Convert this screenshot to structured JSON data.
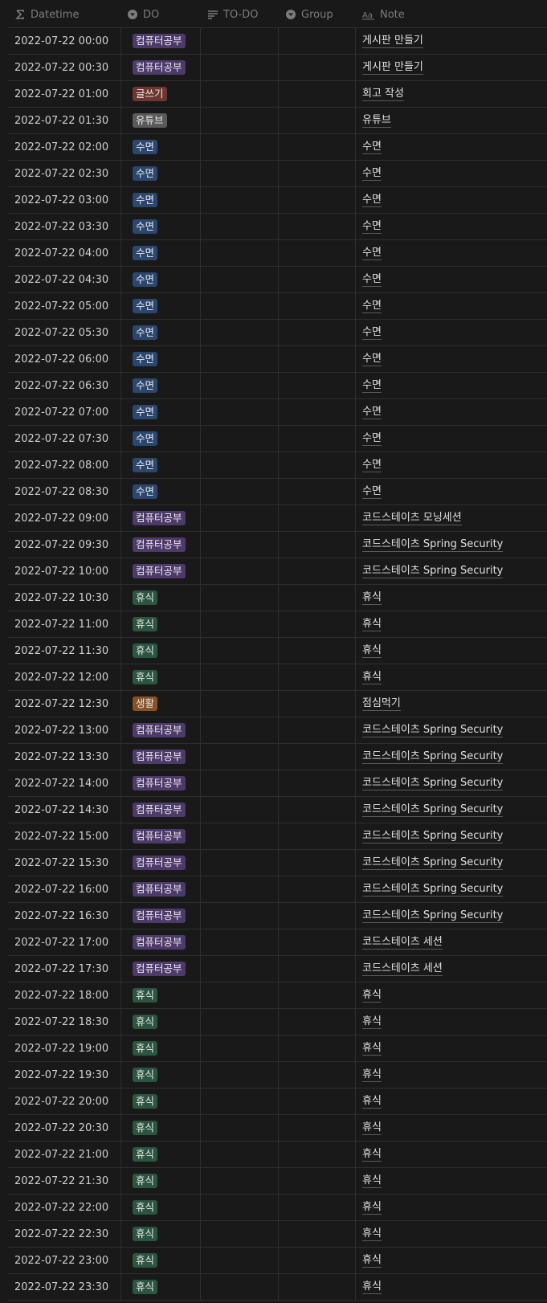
{
  "columns": [
    {
      "key": "datetime",
      "label": "Datetime",
      "icon": "sigma-icon"
    },
    {
      "key": "do",
      "label": "DO",
      "icon": "select-icon"
    },
    {
      "key": "todo",
      "label": "TO-DO",
      "icon": "text-lines-icon"
    },
    {
      "key": "group",
      "label": "Group",
      "icon": "select-icon"
    },
    {
      "key": "note",
      "label": "Note",
      "icon": "text-aa-icon"
    }
  ],
  "tag_colors": {
    "컴퓨터공부": "#4d3a6b",
    "글쓰기": "#6e3630",
    "유튜브": "#5a5a5a",
    "수면": "#2b4770",
    "휴식": "#2b5540",
    "생활": "#8a5224"
  },
  "rows": [
    {
      "datetime": "2022-07-22 00:00",
      "do": "컴퓨터공부",
      "note": "게시판 만들기"
    },
    {
      "datetime": "2022-07-22 00:30",
      "do": "컴퓨터공부",
      "note": "게시판 만들기"
    },
    {
      "datetime": "2022-07-22 01:00",
      "do": "글쓰기",
      "note": "회고 작성"
    },
    {
      "datetime": "2022-07-22 01:30",
      "do": "유튜브",
      "note": "유튜브"
    },
    {
      "datetime": "2022-07-22 02:00",
      "do": "수면",
      "note": "수면"
    },
    {
      "datetime": "2022-07-22 02:30",
      "do": "수면",
      "note": "수면"
    },
    {
      "datetime": "2022-07-22 03:00",
      "do": "수면",
      "note": "수면"
    },
    {
      "datetime": "2022-07-22 03:30",
      "do": "수면",
      "note": "수면"
    },
    {
      "datetime": "2022-07-22 04:00",
      "do": "수면",
      "note": "수면"
    },
    {
      "datetime": "2022-07-22 04:30",
      "do": "수면",
      "note": "수면"
    },
    {
      "datetime": "2022-07-22 05:00",
      "do": "수면",
      "note": "수면"
    },
    {
      "datetime": "2022-07-22 05:30",
      "do": "수면",
      "note": "수면"
    },
    {
      "datetime": "2022-07-22 06:00",
      "do": "수면",
      "note": "수면"
    },
    {
      "datetime": "2022-07-22 06:30",
      "do": "수면",
      "note": "수면"
    },
    {
      "datetime": "2022-07-22 07:00",
      "do": "수면",
      "note": "수면"
    },
    {
      "datetime": "2022-07-22 07:30",
      "do": "수면",
      "note": "수면"
    },
    {
      "datetime": "2022-07-22 08:00",
      "do": "수면",
      "note": "수면"
    },
    {
      "datetime": "2022-07-22 08:30",
      "do": "수면",
      "note": "수면"
    },
    {
      "datetime": "2022-07-22 09:00",
      "do": "컴퓨터공부",
      "note": "코드스테이츠 모닝세션"
    },
    {
      "datetime": "2022-07-22 09:30",
      "do": "컴퓨터공부",
      "note": "코드스테이츠 Spring Security"
    },
    {
      "datetime": "2022-07-22 10:00",
      "do": "컴퓨터공부",
      "note": "코드스테이츠 Spring Security"
    },
    {
      "datetime": "2022-07-22 10:30",
      "do": "휴식",
      "note": "휴식"
    },
    {
      "datetime": "2022-07-22 11:00",
      "do": "휴식",
      "note": "휴식"
    },
    {
      "datetime": "2022-07-22 11:30",
      "do": "휴식",
      "note": "휴식"
    },
    {
      "datetime": "2022-07-22 12:00",
      "do": "휴식",
      "note": "휴식"
    },
    {
      "datetime": "2022-07-22 12:30",
      "do": "생활",
      "note": "점심먹기"
    },
    {
      "datetime": "2022-07-22 13:00",
      "do": "컴퓨터공부",
      "note": "코드스테이츠 Spring Security"
    },
    {
      "datetime": "2022-07-22 13:30",
      "do": "컴퓨터공부",
      "note": "코드스테이츠 Spring Security"
    },
    {
      "datetime": "2022-07-22 14:00",
      "do": "컴퓨터공부",
      "note": "코드스테이츠 Spring Security"
    },
    {
      "datetime": "2022-07-22 14:30",
      "do": "컴퓨터공부",
      "note": "코드스테이츠 Spring Security"
    },
    {
      "datetime": "2022-07-22 15:00",
      "do": "컴퓨터공부",
      "note": "코드스테이츠 Spring Security"
    },
    {
      "datetime": "2022-07-22 15:30",
      "do": "컴퓨터공부",
      "note": "코드스테이츠 Spring Security"
    },
    {
      "datetime": "2022-07-22 16:00",
      "do": "컴퓨터공부",
      "note": "코드스테이츠 Spring Security"
    },
    {
      "datetime": "2022-07-22 16:30",
      "do": "컴퓨터공부",
      "note": "코드스테이츠 Spring Security"
    },
    {
      "datetime": "2022-07-22 17:00",
      "do": "컴퓨터공부",
      "note": "코드스테이츠 세션"
    },
    {
      "datetime": "2022-07-22 17:30",
      "do": "컴퓨터공부",
      "note": "코드스테이츠 세션"
    },
    {
      "datetime": "2022-07-22 18:00",
      "do": "휴식",
      "note": "휴식"
    },
    {
      "datetime": "2022-07-22 18:30",
      "do": "휴식",
      "note": "휴식"
    },
    {
      "datetime": "2022-07-22 19:00",
      "do": "휴식",
      "note": "휴식"
    },
    {
      "datetime": "2022-07-22 19:30",
      "do": "휴식",
      "note": "휴식"
    },
    {
      "datetime": "2022-07-22 20:00",
      "do": "휴식",
      "note": "휴식"
    },
    {
      "datetime": "2022-07-22 20:30",
      "do": "휴식",
      "note": "휴식"
    },
    {
      "datetime": "2022-07-22 21:00",
      "do": "휴식",
      "note": "휴식"
    },
    {
      "datetime": "2022-07-22 21:30",
      "do": "휴식",
      "note": "휴식"
    },
    {
      "datetime": "2022-07-22 22:00",
      "do": "휴식",
      "note": "휴식"
    },
    {
      "datetime": "2022-07-22 22:30",
      "do": "휴식",
      "note": "휴식"
    },
    {
      "datetime": "2022-07-22 23:00",
      "do": "휴식",
      "note": "휴식"
    },
    {
      "datetime": "2022-07-22 23:30",
      "do": "휴식",
      "note": "휴식"
    }
  ]
}
